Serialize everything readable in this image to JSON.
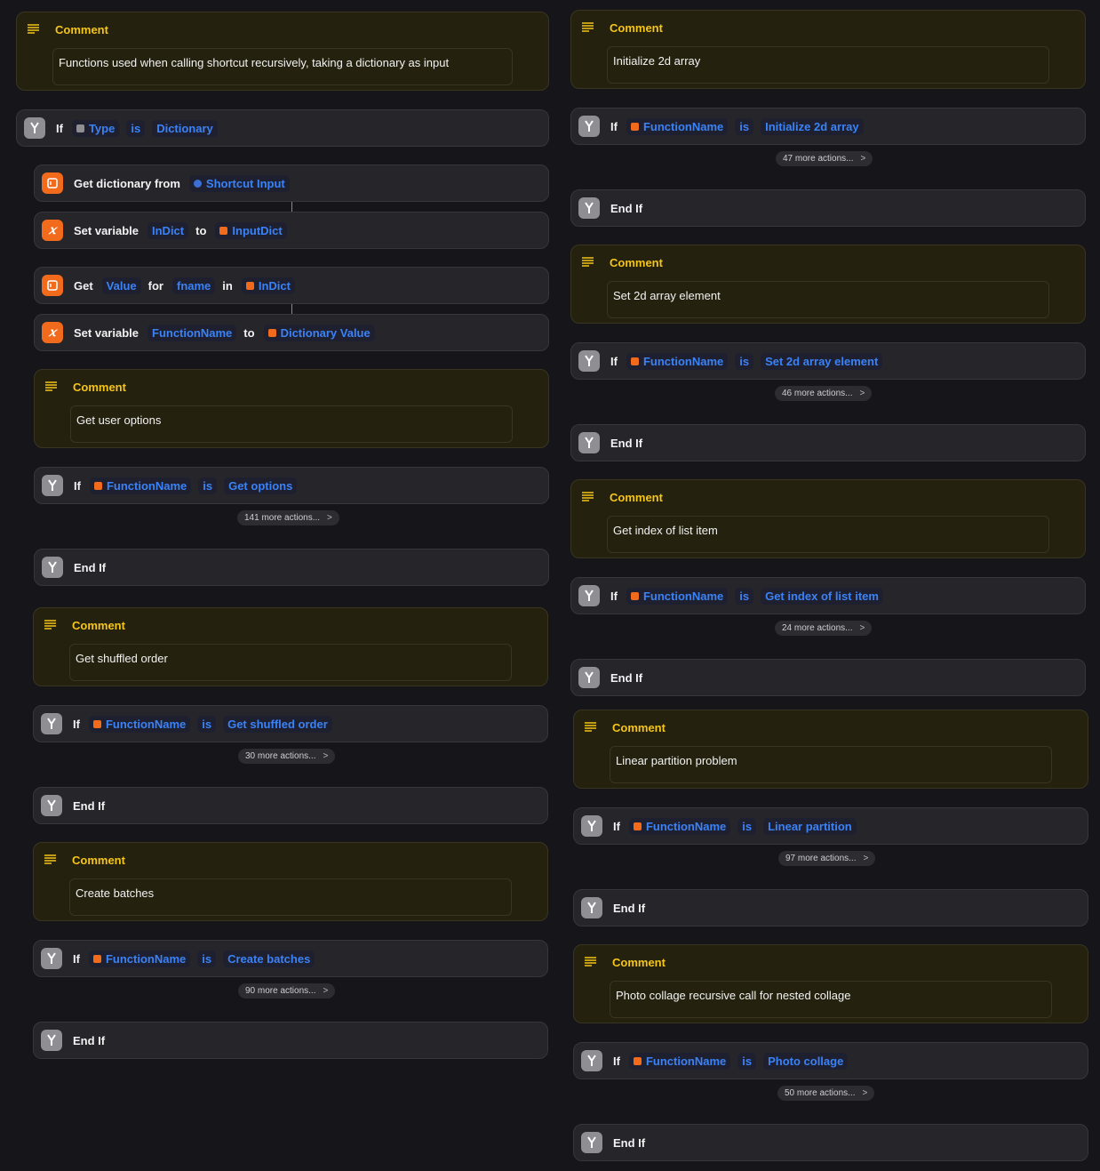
{
  "left": {
    "comment_intro": {
      "title": "Comment",
      "text": "Functions used when calling shortcut recursively, taking a dictionary as input"
    },
    "if_type": {
      "kw": "If",
      "var": "Type",
      "op": "is",
      "value": "Dictionary"
    },
    "get_dict": {
      "kw": "Get dictionary from",
      "var": "Shortcut Input"
    },
    "set_indict": {
      "kw": "Set variable",
      "name": "InDict",
      "to": "to",
      "var": "InputDict"
    },
    "get_value": {
      "kw": "Get",
      "what": "Value",
      "for": "for",
      "key": "fname",
      "in": "in",
      "var": "InDict"
    },
    "set_fname": {
      "kw": "Set variable",
      "name": "FunctionName",
      "to": "to",
      "var": "Dictionary Value"
    },
    "blocks": [
      {
        "comment_title": "Comment",
        "comment_text": "Get user options",
        "if": "If",
        "var": "FunctionName",
        "op": "is",
        "value": "Get options",
        "more": "141 more actions...",
        "end": "End If"
      },
      {
        "comment_title": "Comment",
        "comment_text": "Get shuffled order",
        "if": "If",
        "var": "FunctionName",
        "op": "is",
        "value": "Get shuffled order",
        "more": "30 more actions...",
        "end": "End If"
      },
      {
        "comment_title": "Comment",
        "comment_text": "Create batches",
        "if": "If",
        "var": "FunctionName",
        "op": "is",
        "value": "Create batches",
        "more": "90 more actions...",
        "end": "End If"
      }
    ]
  },
  "right": {
    "blocks": [
      {
        "comment_title": "Comment",
        "comment_text": "Initialize 2d array",
        "if": "If",
        "var": "FunctionName",
        "op": "is",
        "value": "Initialize 2d array",
        "more": "47 more actions...",
        "end": "End If"
      },
      {
        "comment_title": "Comment",
        "comment_text": "Set 2d array element",
        "if": "If",
        "var": "FunctionName",
        "op": "is",
        "value": "Set 2d array element",
        "more": "46 more actions...",
        "end": "End If"
      },
      {
        "comment_title": "Comment",
        "comment_text": "Get index of list item",
        "if": "If",
        "var": "FunctionName",
        "op": "is",
        "value": "Get index of list item",
        "more": "24 more actions...",
        "end": "End If"
      },
      {
        "comment_title": "Comment",
        "comment_text": "Linear partition problem",
        "if": "If",
        "var": "FunctionName",
        "op": "is",
        "value": "Linear partition",
        "more": "97 more actions...",
        "end": "End If"
      },
      {
        "comment_title": "Comment",
        "comment_text": "Photo collage recursive call for nested collage",
        "if": "If",
        "var": "FunctionName",
        "op": "is",
        "value": "Photo collage",
        "more": "50 more actions...",
        "end": "End If"
      }
    ]
  },
  "colors": {
    "background": "#16161a",
    "card": "#25252a",
    "comment": "#25210f",
    "token": "#3b82f6",
    "comment_title": "#f5c518",
    "orange_icon": "#f26a1b",
    "gray_icon": "#8e8e93"
  },
  "icons": [
    "if-branch-icon",
    "comment-lines-icon",
    "dictionary-icon",
    "variable-icon"
  ]
}
